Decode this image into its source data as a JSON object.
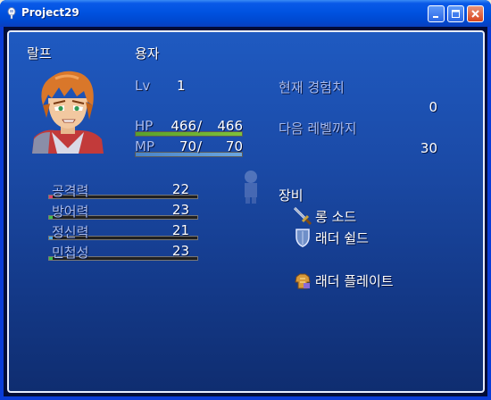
{
  "window": {
    "title": "Project29"
  },
  "actor": {
    "name": "랄프",
    "class": "용자",
    "level_label": "Lv",
    "level": "1",
    "hp_label": "HP",
    "hp": "466",
    "mhp": "466",
    "hp_ratio": 1.0,
    "mp_label": "MP",
    "mp": "70",
    "mmp": "70",
    "mp_ratio": 1.0
  },
  "exp": {
    "current_label": "현재 경험치",
    "current": "0",
    "next_label": "다음 레벨까지",
    "next": "30"
  },
  "params": [
    {
      "label": "공격력",
      "value": "22",
      "color": "#e0406a"
    },
    {
      "label": "방어력",
      "value": "23",
      "color": "#3fbf4a"
    },
    {
      "label": "정신력",
      "value": "21",
      "color": "#48a8e8"
    },
    {
      "label": "민첩성",
      "value": "23",
      "color": "#3fbf4a"
    }
  ],
  "equipment": {
    "heading": "장비",
    "items": [
      {
        "name": "롱 소드",
        "icon": "sword-icon"
      },
      {
        "name": "래더 쉴드",
        "icon": "shield-icon"
      },
      {
        "name": "",
        "icon": ""
      },
      {
        "name": "래더 플레이트",
        "icon": "armor-icon"
      }
    ]
  },
  "colors": {
    "hp_fill": "#7fc13a",
    "mp_fill": "#6aa6e0",
    "system_text": "#a7bbef"
  }
}
